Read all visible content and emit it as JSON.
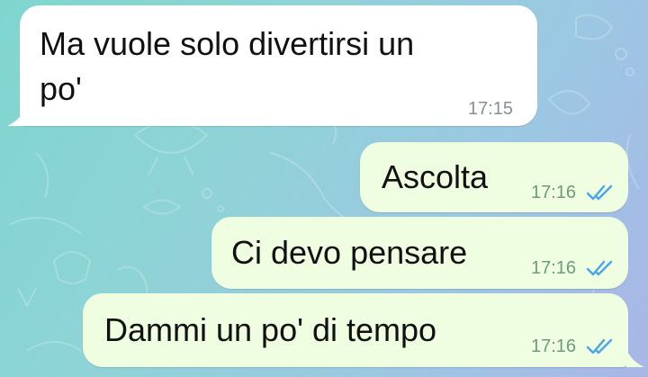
{
  "chat": {
    "messages": [
      {
        "direction": "incoming",
        "text_line1": "Ma vuole solo divertirsi un",
        "text_line2": "po'",
        "time": "17:15"
      },
      {
        "direction": "outgoing",
        "text": "Ascolta",
        "time": "17:16",
        "status_icon": "double-check-icon"
      },
      {
        "direction": "outgoing",
        "text": "Ci devo pensare",
        "time": "17:16",
        "status_icon": "double-check-icon"
      },
      {
        "direction": "outgoing",
        "text": "Dammi un po' di tempo",
        "time": "17:16",
        "status_icon": "double-check-icon"
      }
    ]
  },
  "colors": {
    "incoming_bubble": "#ffffff",
    "outgoing_bubble": "#effde0",
    "read_check": "#4aa6e8"
  }
}
